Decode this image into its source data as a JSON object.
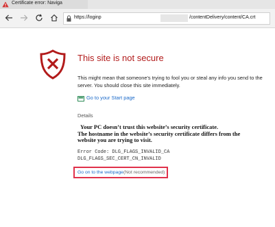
{
  "browser": {
    "tab_title": "Certificate error: Naviga",
    "address": {
      "url_prefix": "https://loginp",
      "url_suffix": "/contentDelivery/content/CA.crt"
    }
  },
  "page": {
    "title": "This site is not secure",
    "description": "This might mean that someone's trying to fool you or steal any info you send to the server. You should close this site immediately.",
    "start_link": "Go to your Start page",
    "details_label": "Details",
    "warning_lines": [
      "Your PC doesn’t trust this website’s security certificate.",
      "The hostname in the website’s security certificate differs from the",
      "website you are trying to visit."
    ],
    "error_code_lines": [
      "Error Code: DLG_FLAGS_INVALID_CA",
      "DLG_FLAGS_SEC_CERT_CN_INVALID"
    ],
    "go_on_link": "Go on to the webpage",
    "go_on_note": "(Not recommended)"
  },
  "colors": {
    "title_red": "#b21b1b",
    "shield_red": "#b21b1b",
    "link_blue": "#1b6ac9",
    "highlight_box": "#e0304a"
  }
}
